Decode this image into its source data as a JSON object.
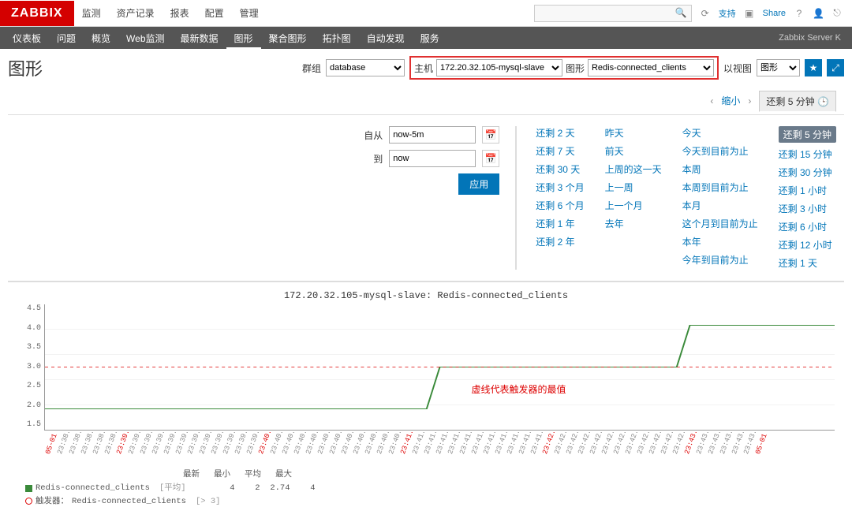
{
  "logo": "ZABBIX",
  "topnav": [
    "监测",
    "资产记录",
    "报表",
    "配置",
    "管理"
  ],
  "topright": {
    "support": "支持",
    "share": "Share"
  },
  "subnav": [
    "仪表板",
    "问题",
    "概览",
    "Web监测",
    "最新数据",
    "图形",
    "聚合图形",
    "拓扑图",
    "自动发现",
    "服务"
  ],
  "subnav_active": 5,
  "subright": "Zabbix Server K",
  "page_title": "图形",
  "filters": {
    "group_label": "群组",
    "group_value": "database",
    "host_label": "主机",
    "host_value": "172.20.32.105-mysql-slave",
    "graph_label": "图形",
    "graph_value": "Redis-connected_clients",
    "view_label": "以视图",
    "view_value": "图形"
  },
  "time": {
    "from_label": "自从",
    "from_value": "now-5m",
    "to_label": "到",
    "to_value": "now",
    "apply": "应用",
    "tab_shrink": "缩小",
    "tab_active": "还剩 5 分钟",
    "presets": {
      "c1": [
        "还剩 2 天",
        "还剩 7 天",
        "还剩 30 天",
        "还剩 3 个月",
        "还剩 6 个月",
        "还剩 1 年",
        "还剩 2 年"
      ],
      "c2": [
        "昨天",
        "前天",
        "上周的这一天",
        "上一周",
        "上一个月",
        "去年"
      ],
      "c3": [
        "今天",
        "今天到目前为止",
        "本周",
        "本周到目前为止",
        "本月",
        "这个月到目前为止",
        "本年",
        "今年到目前为止"
      ],
      "c4": [
        "还剩 5 分钟",
        "还剩 15 分钟",
        "还剩 30 分钟",
        "还剩 1 小时",
        "还剩 3 小时",
        "还剩 6 小时",
        "还剩 12 小时",
        "还剩 1 天"
      ],
      "selected": "还剩 5 分钟"
    }
  },
  "annotation": "虚线代表触发器的最值",
  "legend": {
    "headers": [
      "最新",
      "最小",
      "平均",
      "最大"
    ],
    "series": "Redis-connected_clients",
    "series_tag": "[平均]",
    "vals": [
      "4",
      "2",
      "2.74",
      "4"
    ],
    "trigger_label": "触发器：",
    "trigger_name": "Redis-connected_clients",
    "trigger_cond": "[> 3]"
  },
  "chart_data": {
    "type": "line",
    "title": "172.20.32.105-mysql-slave: Redis-connected_clients",
    "xlabel": "",
    "ylabel": "",
    "ylim": [
      1.5,
      4.5
    ],
    "yticks": [
      4.5,
      4.0,
      3.5,
      3.0,
      2.5,
      2.0,
      1.5
    ],
    "x": [
      "05-01 23:38",
      "23:38:35",
      "23:38:40",
      "23:38:45",
      "23:38:50",
      "23:38:55",
      "23:39:00",
      "23:39:05",
      "23:39:10",
      "23:39:15",
      "23:39:20",
      "23:39:25",
      "23:39:30",
      "23:39:35",
      "23:39:40",
      "23:39:45",
      "23:39:50",
      "23:39:55",
      "23:40:00",
      "23:40:05",
      "23:40:10",
      "23:40:15",
      "23:40:20",
      "23:40:25",
      "23:40:30",
      "23:40:35",
      "23:40:40",
      "23:40:45",
      "23:40:50",
      "23:40:55",
      "23:41:00",
      "23:41:05",
      "23:41:10",
      "23:41:15",
      "23:41:20",
      "23:41:25",
      "23:41:30",
      "23:41:35",
      "23:41:40",
      "23:41:45",
      "23:41:50",
      "23:41:55",
      "23:42:00",
      "23:42:05",
      "23:42:10",
      "23:42:15",
      "23:42:20",
      "23:42:25",
      "23:42:30",
      "23:42:35",
      "23:42:40",
      "23:42:45",
      "23:42:50",
      "23:42:55",
      "23:43:00",
      "23:43:05",
      "23:43:10",
      "23:43:15",
      "23:43:20",
      "23:43:25",
      "05-01 23:43"
    ],
    "x_red": [
      0,
      6,
      18,
      30,
      42,
      54,
      60
    ],
    "series": [
      {
        "name": "Redis-connected_clients",
        "color": "#3a8a3a",
        "values": [
          2,
          2,
          2,
          2,
          2,
          2,
          2,
          2,
          2,
          2,
          2,
          2,
          2,
          2,
          2,
          2,
          2,
          2,
          2,
          2,
          2,
          2,
          2,
          2,
          2,
          2,
          2,
          2,
          2,
          2,
          3,
          3,
          3,
          3,
          3,
          3,
          3,
          3,
          3,
          3,
          3,
          3,
          3,
          3,
          3,
          3,
          3,
          3,
          3,
          4,
          4,
          4,
          4,
          4,
          4,
          4,
          4,
          4,
          4,
          4,
          4
        ]
      }
    ],
    "trigger_line": 3
  }
}
